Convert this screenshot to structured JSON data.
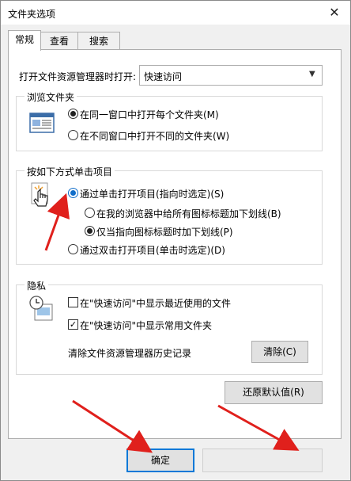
{
  "window": {
    "title": "文件夹选项",
    "close_glyph": "✕"
  },
  "tabs": [
    {
      "label": "常规",
      "active": true
    },
    {
      "label": "查看",
      "active": false
    },
    {
      "label": "搜索",
      "active": false
    }
  ],
  "open_explorer": {
    "label": "打开文件资源管理器时打开:",
    "value": "快速访问"
  },
  "browse_folders": {
    "title": "浏览文件夹",
    "icon": "folder-windows-icon",
    "options": [
      {
        "label": "在同一窗口中打开每个文件夹(M)",
        "checked": true
      },
      {
        "label": "在不同窗口中打开不同的文件夹(W)",
        "checked": false
      }
    ]
  },
  "click_items": {
    "title": "按如下方式单击项目",
    "icon": "hand-pointer-icon",
    "options": [
      {
        "label": "通过单击打开项目(指向时选定)(S)",
        "checked": true
      },
      {
        "label": "在我的浏览器中给所有图标标题加下划线(B)",
        "checked": false
      },
      {
        "label": "仅当指向图标标题时加下划线(P)",
        "checked": true
      },
      {
        "label": "通过双击打开项目(单击时选定)(D)",
        "checked": false
      }
    ]
  },
  "privacy": {
    "title": "隐私",
    "icon": "privacy-clock-icon",
    "checks": [
      {
        "label": "在\"快速访问\"中显示最近使用的文件",
        "checked": false
      },
      {
        "label": "在\"快速访问\"中显示常用文件夹",
        "checked": true
      }
    ],
    "clear_history_label": "清除文件资源管理器历史记录",
    "clear_button": "清除(C)",
    "check_glyph": "✓"
  },
  "restore_defaults": "还原默认值(R)",
  "footer": {
    "ok": "确定",
    "cancel": ""
  },
  "annotation": {
    "arrow_color": "#e0201c"
  }
}
